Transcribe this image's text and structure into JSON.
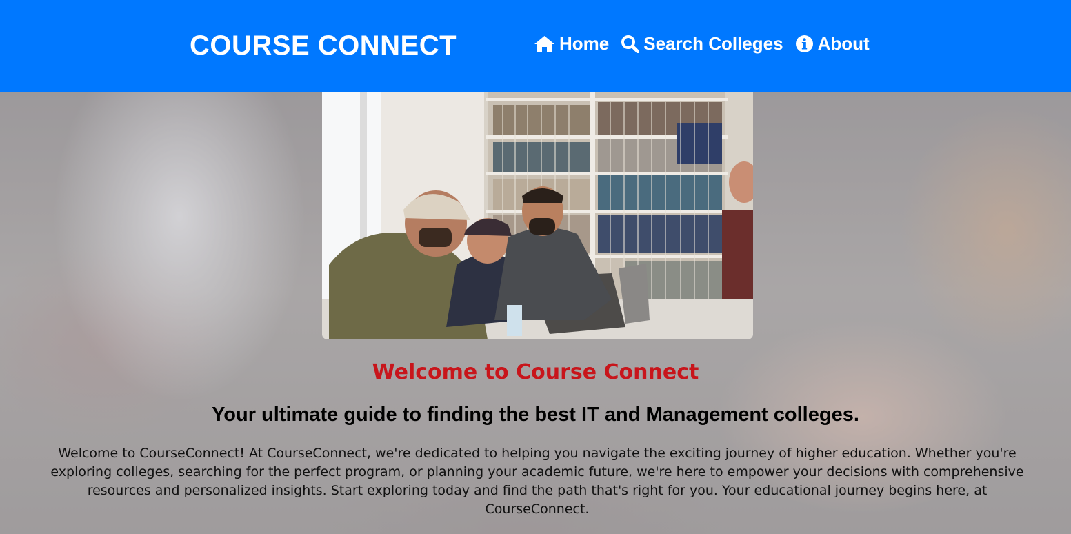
{
  "header": {
    "brand": "COURSE CONNECT",
    "nav": [
      {
        "label": "Home",
        "icon": "home-icon"
      },
      {
        "label": "Search Colleges",
        "icon": "search-icon"
      },
      {
        "label": "About",
        "icon": "info-icon"
      }
    ]
  },
  "main": {
    "welcome_heading": "Welcome to Course Connect",
    "tagline": "Your ultimate guide to finding the best IT and Management colleges.",
    "intro_text": "Welcome to CourseConnect! At CourseConnect, we're dedicated to helping you navigate the exciting journey of higher education. Whether you're exploring colleges, searching for the perfect program, or planning your academic future, we're here to empower your decisions with comprehensive resources and personalized insights. Start exploring today and find the path that's right for you. Your educational journey begins here, at CourseConnect."
  },
  "colors": {
    "header_bg": "#0078ff",
    "accent_red": "#c8151b",
    "text": "#000000"
  }
}
